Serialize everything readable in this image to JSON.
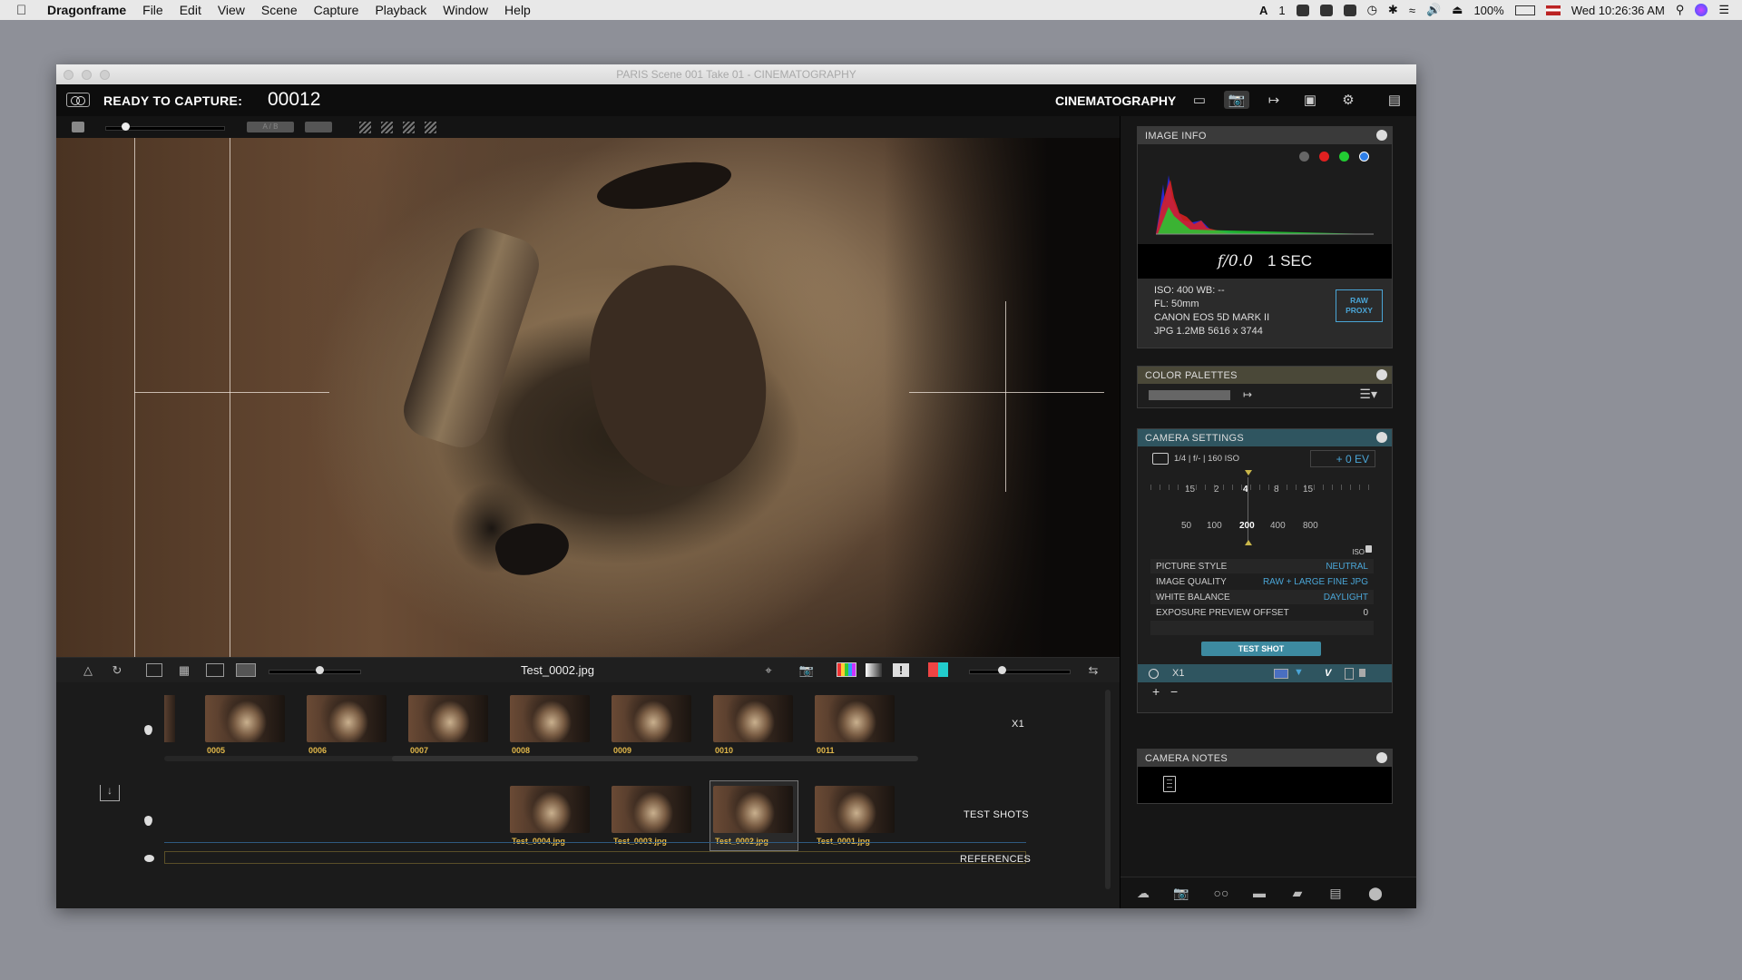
{
  "menubar": {
    "app_name": "Dragonframe",
    "menus": [
      "File",
      "Edit",
      "View",
      "Scene",
      "Capture",
      "Playback",
      "Window",
      "Help"
    ],
    "status_count": "1",
    "battery": "100%",
    "clock": "Wed 10:26:36 AM"
  },
  "window": {
    "title": "PARIS  Scene 001  Take 01 - CINEMATOGRAPHY"
  },
  "toolbar": {
    "status": "READY TO CAPTURE:",
    "frame_number": "00012",
    "workspace": "CINEMATOGRAPHY"
  },
  "subbar": {
    "ab_label": "A / B"
  },
  "viewbar": {
    "filename": "Test_0002.jpg"
  },
  "timeline": {
    "main_row_label": "X1",
    "frames": [
      "0005",
      "0006",
      "0007",
      "0008",
      "0009",
      "0010",
      "0011"
    ],
    "test_row_label": "TEST SHOTS",
    "test_shots": [
      "Test_0004.jpg",
      "Test_0003.jpg",
      "Test_0002.jpg",
      "Test_0001.jpg"
    ],
    "references_label": "REFERENCES"
  },
  "image_info": {
    "header": "IMAGE INFO",
    "aperture": "f/0.0",
    "shutter": "1 SEC",
    "iso_wb": "ISO: 400   WB: --",
    "focal_length": "FL: 50mm",
    "camera": "CANON EOS 5D MARK II",
    "file_info": "JPG  1.2MB  5616 x 3744",
    "raw_proxy_line1": "RAW",
    "raw_proxy_line2": "PROXY",
    "channel_colors": [
      "#666666",
      "#e02020",
      "#22cc33",
      "#2f7fe8"
    ]
  },
  "color_palettes": {
    "header": "COLOR PALETTES"
  },
  "camera_settings": {
    "header": "CAMERA SETTINGS",
    "summary": "1/4  |  f/-  |  160 ISO",
    "ev": "+ 0 EV",
    "shutter_scale": [
      "15",
      "2",
      "4",
      "8",
      "15"
    ],
    "iso_scale": [
      "50",
      "100",
      "200",
      "400",
      "800"
    ],
    "iso_label": "ISO",
    "settings": [
      {
        "key": "PICTURE STYLE",
        "value": "NEUTRAL"
      },
      {
        "key": "IMAGE QUALITY",
        "value": "RAW + LARGE FINE JPG"
      },
      {
        "key": "WHITE BALANCE",
        "value": "DAYLIGHT"
      },
      {
        "key": "EXPOSURE PREVIEW OFFSET",
        "value": "0"
      }
    ],
    "test_shot_button": "TEST SHOT",
    "exposure_label": "X1",
    "exposure_letter": "V",
    "add": "+",
    "remove": "−"
  },
  "camera_notes": {
    "header": "CAMERA NOTES"
  }
}
